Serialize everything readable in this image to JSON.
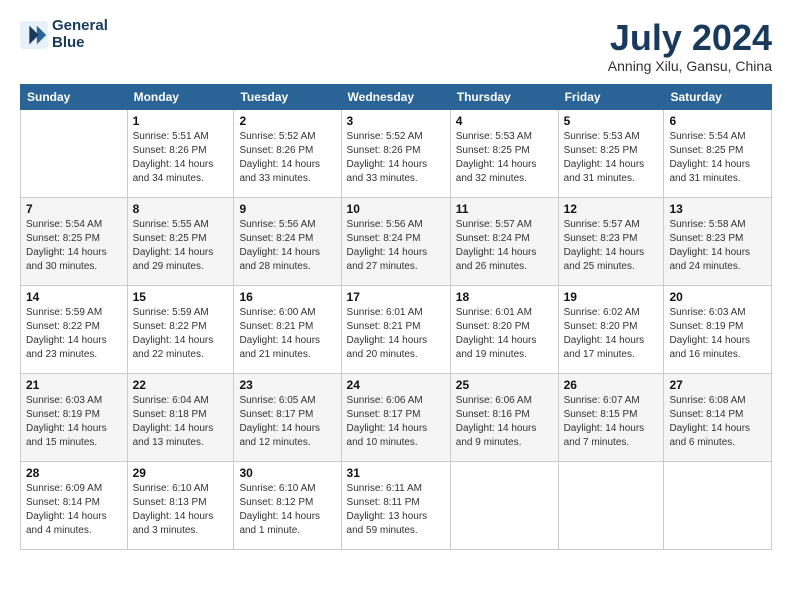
{
  "logo": {
    "line1": "General",
    "line2": "Blue"
  },
  "title": "July 2024",
  "subtitle": "Anning Xilu, Gansu, China",
  "headers": [
    "Sunday",
    "Monday",
    "Tuesday",
    "Wednesday",
    "Thursday",
    "Friday",
    "Saturday"
  ],
  "weeks": [
    [
      {
        "day": "",
        "info": ""
      },
      {
        "day": "1",
        "info": "Sunrise: 5:51 AM\nSunset: 8:26 PM\nDaylight: 14 hours\nand 34 minutes."
      },
      {
        "day": "2",
        "info": "Sunrise: 5:52 AM\nSunset: 8:26 PM\nDaylight: 14 hours\nand 33 minutes."
      },
      {
        "day": "3",
        "info": "Sunrise: 5:52 AM\nSunset: 8:26 PM\nDaylight: 14 hours\nand 33 minutes."
      },
      {
        "day": "4",
        "info": "Sunrise: 5:53 AM\nSunset: 8:25 PM\nDaylight: 14 hours\nand 32 minutes."
      },
      {
        "day": "5",
        "info": "Sunrise: 5:53 AM\nSunset: 8:25 PM\nDaylight: 14 hours\nand 31 minutes."
      },
      {
        "day": "6",
        "info": "Sunrise: 5:54 AM\nSunset: 8:25 PM\nDaylight: 14 hours\nand 31 minutes."
      }
    ],
    [
      {
        "day": "7",
        "info": "Sunrise: 5:54 AM\nSunset: 8:25 PM\nDaylight: 14 hours\nand 30 minutes."
      },
      {
        "day": "8",
        "info": "Sunrise: 5:55 AM\nSunset: 8:25 PM\nDaylight: 14 hours\nand 29 minutes."
      },
      {
        "day": "9",
        "info": "Sunrise: 5:56 AM\nSunset: 8:24 PM\nDaylight: 14 hours\nand 28 minutes."
      },
      {
        "day": "10",
        "info": "Sunrise: 5:56 AM\nSunset: 8:24 PM\nDaylight: 14 hours\nand 27 minutes."
      },
      {
        "day": "11",
        "info": "Sunrise: 5:57 AM\nSunset: 8:24 PM\nDaylight: 14 hours\nand 26 minutes."
      },
      {
        "day": "12",
        "info": "Sunrise: 5:57 AM\nSunset: 8:23 PM\nDaylight: 14 hours\nand 25 minutes."
      },
      {
        "day": "13",
        "info": "Sunrise: 5:58 AM\nSunset: 8:23 PM\nDaylight: 14 hours\nand 24 minutes."
      }
    ],
    [
      {
        "day": "14",
        "info": "Sunrise: 5:59 AM\nSunset: 8:22 PM\nDaylight: 14 hours\nand 23 minutes."
      },
      {
        "day": "15",
        "info": "Sunrise: 5:59 AM\nSunset: 8:22 PM\nDaylight: 14 hours\nand 22 minutes."
      },
      {
        "day": "16",
        "info": "Sunrise: 6:00 AM\nSunset: 8:21 PM\nDaylight: 14 hours\nand 21 minutes."
      },
      {
        "day": "17",
        "info": "Sunrise: 6:01 AM\nSunset: 8:21 PM\nDaylight: 14 hours\nand 20 minutes."
      },
      {
        "day": "18",
        "info": "Sunrise: 6:01 AM\nSunset: 8:20 PM\nDaylight: 14 hours\nand 19 minutes."
      },
      {
        "day": "19",
        "info": "Sunrise: 6:02 AM\nSunset: 8:20 PM\nDaylight: 14 hours\nand 17 minutes."
      },
      {
        "day": "20",
        "info": "Sunrise: 6:03 AM\nSunset: 8:19 PM\nDaylight: 14 hours\nand 16 minutes."
      }
    ],
    [
      {
        "day": "21",
        "info": "Sunrise: 6:03 AM\nSunset: 8:19 PM\nDaylight: 14 hours\nand 15 minutes."
      },
      {
        "day": "22",
        "info": "Sunrise: 6:04 AM\nSunset: 8:18 PM\nDaylight: 14 hours\nand 13 minutes."
      },
      {
        "day": "23",
        "info": "Sunrise: 6:05 AM\nSunset: 8:17 PM\nDaylight: 14 hours\nand 12 minutes."
      },
      {
        "day": "24",
        "info": "Sunrise: 6:06 AM\nSunset: 8:17 PM\nDaylight: 14 hours\nand 10 minutes."
      },
      {
        "day": "25",
        "info": "Sunrise: 6:06 AM\nSunset: 8:16 PM\nDaylight: 14 hours\nand 9 minutes."
      },
      {
        "day": "26",
        "info": "Sunrise: 6:07 AM\nSunset: 8:15 PM\nDaylight: 14 hours\nand 7 minutes."
      },
      {
        "day": "27",
        "info": "Sunrise: 6:08 AM\nSunset: 8:14 PM\nDaylight: 14 hours\nand 6 minutes."
      }
    ],
    [
      {
        "day": "28",
        "info": "Sunrise: 6:09 AM\nSunset: 8:14 PM\nDaylight: 14 hours\nand 4 minutes."
      },
      {
        "day": "29",
        "info": "Sunrise: 6:10 AM\nSunset: 8:13 PM\nDaylight: 14 hours\nand 3 minutes."
      },
      {
        "day": "30",
        "info": "Sunrise: 6:10 AM\nSunset: 8:12 PM\nDaylight: 14 hours\nand 1 minute."
      },
      {
        "day": "31",
        "info": "Sunrise: 6:11 AM\nSunset: 8:11 PM\nDaylight: 13 hours\nand 59 minutes."
      },
      {
        "day": "",
        "info": ""
      },
      {
        "day": "",
        "info": ""
      },
      {
        "day": "",
        "info": ""
      }
    ]
  ]
}
